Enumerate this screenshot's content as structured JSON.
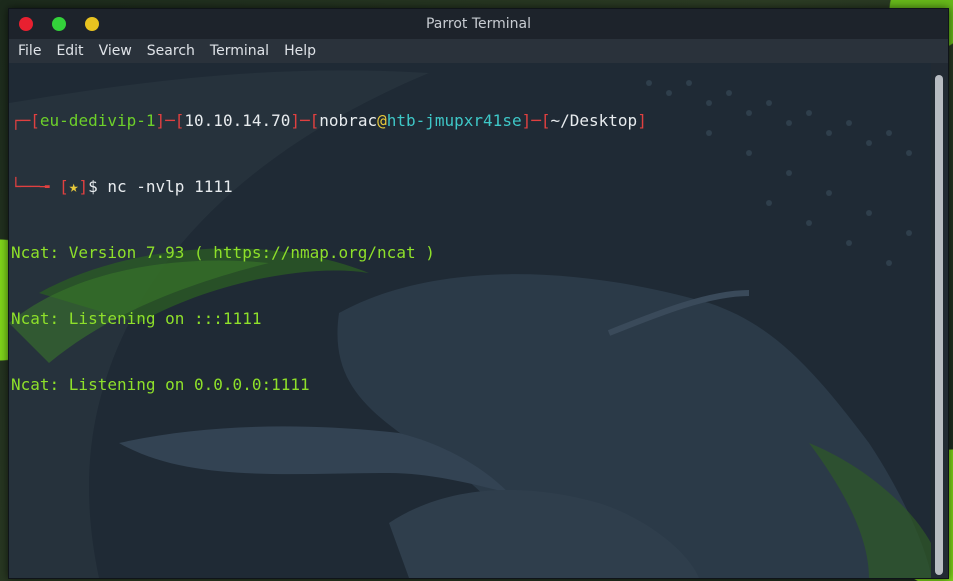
{
  "window": {
    "title": "Parrot Terminal"
  },
  "menu": {
    "items": [
      "File",
      "Edit",
      "View",
      "Search",
      "Terminal",
      "Help"
    ]
  },
  "prompt": {
    "corner_top": "┌─",
    "corner_bottom": "└──╼ ",
    "host_tag": "eu-dedivip-1",
    "ip": "10.10.14.70",
    "user": "nobrac",
    "at": "@",
    "machine": "htb-jmupxr41se",
    "cwd": "~/Desktop",
    "star": "★",
    "dollar": "$",
    "command": " nc -nvlp 1111"
  },
  "output": [
    "Ncat: Version 7.93 ( https://nmap.org/ncat )",
    "Ncat: Listening on :::1111",
    "Ncat: Listening on 0.0.0.0:1111"
  ],
  "colors": {
    "accent": "#7ed31a",
    "terminal_bg": "#1f2a35",
    "close": "#e82030",
    "maximize": "#33d13a",
    "minimize": "#e8c320"
  }
}
